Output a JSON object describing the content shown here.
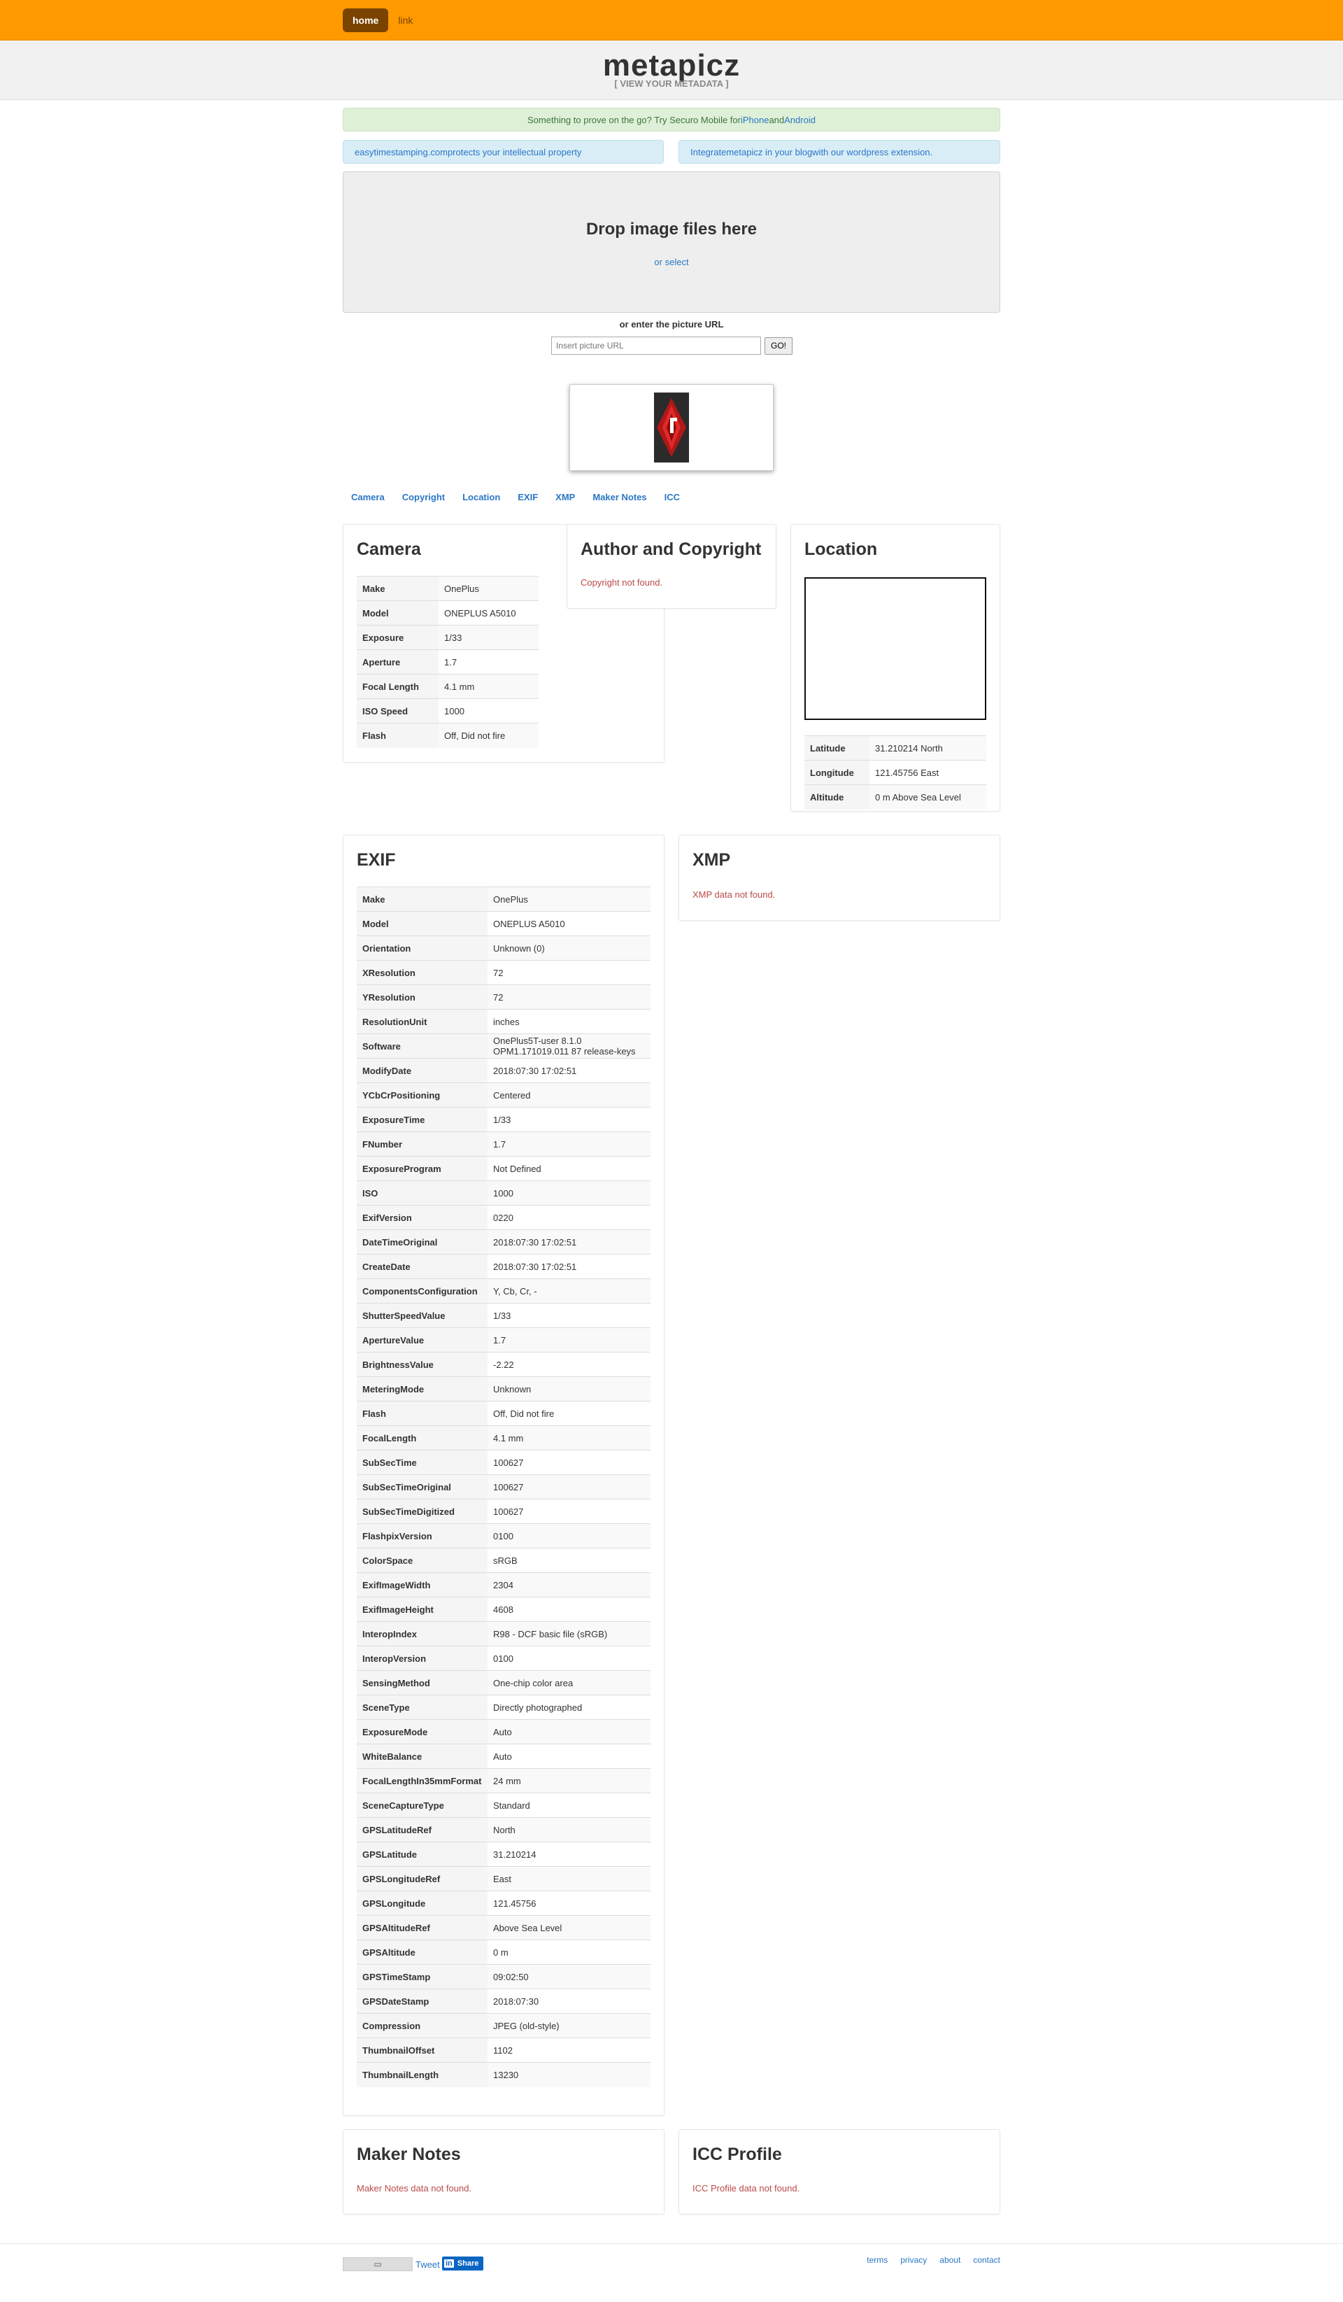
{
  "nav": {
    "home": "home",
    "link": "link"
  },
  "header": {
    "brand": "metapicz",
    "tagline": "[ VIEW YOUR METADATA ]"
  },
  "alerts": {
    "mobile_prefix": "Something to prove on the go? Try Securo Mobile for ",
    "mobile_iphone": "iPhone",
    "mobile_and": " and ",
    "mobile_android": "Android",
    "timestamp_link": "easytimestamping.com",
    "timestamp_text": " protects your intellectual property",
    "integrate_prefix": "Integrate ",
    "integrate_link": "metapicz in your blog",
    "integrate_suffix": " with our wordpress extension."
  },
  "upload": {
    "drop_title": "Drop image files here",
    "select_label": "or select",
    "url_label": "or enter the picture URL",
    "url_placeholder": "Insert picture URL",
    "go_label": "GO!"
  },
  "sections": [
    "Camera",
    "Copyright",
    "Location",
    "EXIF",
    "XMP",
    "Maker Notes",
    "ICC"
  ],
  "camera": {
    "title": "Camera",
    "rows": [
      [
        "Make",
        "OnePlus"
      ],
      [
        "Model",
        "ONEPLUS A5010"
      ],
      [
        "Exposure",
        "1/33"
      ],
      [
        "Aperture",
        "1.7"
      ],
      [
        "Focal Length",
        "4.1 mm"
      ],
      [
        "ISO Speed",
        "1000"
      ],
      [
        "Flash",
        "Off, Did not fire"
      ]
    ]
  },
  "copyright": {
    "title": "Author and Copyright",
    "message": "Copyright not found."
  },
  "location": {
    "title": "Location",
    "rows": [
      [
        "Latitude",
        "31.210214 North"
      ],
      [
        "Longitude",
        "121.45756 East"
      ],
      [
        "Altitude",
        "0 m Above Sea Level"
      ]
    ]
  },
  "exif": {
    "title": "EXIF",
    "rows": [
      [
        "Make",
        "OnePlus"
      ],
      [
        "Model",
        "ONEPLUS A5010"
      ],
      [
        "Orientation",
        "Unknown (0)"
      ],
      [
        "XResolution",
        "72"
      ],
      [
        "YResolution",
        "72"
      ],
      [
        "ResolutionUnit",
        "inches"
      ],
      [
        "Software",
        "OnePlus5T-user 8.1.0 OPM1.171019.011 87 release-keys"
      ],
      [
        "ModifyDate",
        "2018:07:30 17:02:51"
      ],
      [
        "YCbCrPositioning",
        "Centered"
      ],
      [
        "ExposureTime",
        "1/33"
      ],
      [
        "FNumber",
        "1.7"
      ],
      [
        "ExposureProgram",
        "Not Defined"
      ],
      [
        "ISO",
        "1000"
      ],
      [
        "ExifVersion",
        "0220"
      ],
      [
        "DateTimeOriginal",
        "2018:07:30 17:02:51"
      ],
      [
        "CreateDate",
        "2018:07:30 17:02:51"
      ],
      [
        "ComponentsConfiguration",
        "Y, Cb, Cr, -"
      ],
      [
        "ShutterSpeedValue",
        "1/33"
      ],
      [
        "ApertureValue",
        "1.7"
      ],
      [
        "BrightnessValue",
        "-2.22"
      ],
      [
        "MeteringMode",
        "Unknown"
      ],
      [
        "Flash",
        "Off, Did not fire"
      ],
      [
        "FocalLength",
        "4.1 mm"
      ],
      [
        "SubSecTime",
        "100627"
      ],
      [
        "SubSecTimeOriginal",
        "100627"
      ],
      [
        "SubSecTimeDigitized",
        "100627"
      ],
      [
        "FlashpixVersion",
        "0100"
      ],
      [
        "ColorSpace",
        "sRGB"
      ],
      [
        "ExifImageWidth",
        "2304"
      ],
      [
        "ExifImageHeight",
        "4608"
      ],
      [
        "InteropIndex",
        "R98 - DCF basic file (sRGB)"
      ],
      [
        "InteropVersion",
        "0100"
      ],
      [
        "SensingMethod",
        "One-chip color area"
      ],
      [
        "SceneType",
        "Directly photographed"
      ],
      [
        "ExposureMode",
        "Auto"
      ],
      [
        "WhiteBalance",
        "Auto"
      ],
      [
        "FocalLengthIn35mmFormat",
        "24 mm"
      ],
      [
        "SceneCaptureType",
        "Standard"
      ],
      [
        "GPSLatitudeRef",
        "North"
      ],
      [
        "GPSLatitude",
        "31.210214"
      ],
      [
        "GPSLongitudeRef",
        "East"
      ],
      [
        "GPSLongitude",
        "121.45756"
      ],
      [
        "GPSAltitudeRef",
        "Above Sea Level"
      ],
      [
        "GPSAltitude",
        "0 m"
      ],
      [
        "GPSTimeStamp",
        "09:02:50"
      ],
      [
        "GPSDateStamp",
        "2018:07:30"
      ],
      [
        "Compression",
        "JPEG (old-style)"
      ],
      [
        "ThumbnailOffset",
        "1102"
      ],
      [
        "ThumbnailLength",
        "13230"
      ]
    ]
  },
  "xmp": {
    "title": "XMP",
    "message": "XMP data not found."
  },
  "maker_notes": {
    "title": "Maker Notes",
    "message": "Maker Notes data not found."
  },
  "icc": {
    "title": "ICC Profile",
    "message": "ICC Profile data not found."
  },
  "footer": {
    "tweet": "Tweet",
    "linkedin_badge": "in",
    "linkedin_share": "Share",
    "links": [
      "terms",
      "privacy",
      "about",
      "contact"
    ]
  },
  "colors": {
    "accent": "#ff9900",
    "link": "#2a77c4",
    "error": "#b94a48",
    "gem": "#cc1f1f"
  }
}
